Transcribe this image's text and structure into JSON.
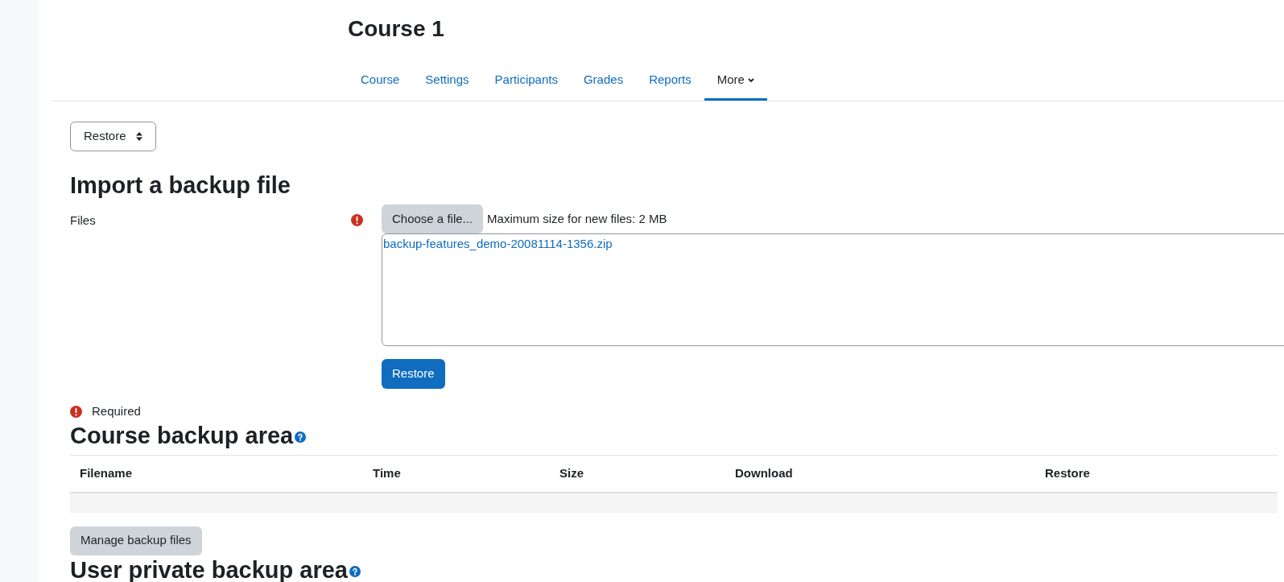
{
  "page_title": "Course 1",
  "tabs": [
    {
      "label": "Course",
      "selected": false,
      "dropdown": false
    },
    {
      "label": "Settings",
      "selected": false,
      "dropdown": false
    },
    {
      "label": "Participants",
      "selected": false,
      "dropdown": false
    },
    {
      "label": "Grades",
      "selected": false,
      "dropdown": false
    },
    {
      "label": "Reports",
      "selected": false,
      "dropdown": false
    },
    {
      "label": "More",
      "selected": true,
      "dropdown": true
    }
  ],
  "action_select": {
    "value": "Restore"
  },
  "import_section": {
    "heading": "Import a backup file",
    "field_label": "Files",
    "required": true,
    "choose_button": "Choose a file...",
    "max_size": "Maximum size for new files: 2 MB",
    "files": [
      "backup-features_demo-20081114-1356.zip"
    ],
    "submit_button": "Restore",
    "required_note": "Required"
  },
  "course_backup_area": {
    "heading": "Course backup area",
    "table": {
      "columns": [
        "Filename",
        "Time",
        "Size",
        "Download",
        "Restore"
      ]
    },
    "manage_button": "Manage backup files"
  },
  "user_private_backup_area": {
    "heading": "User private backup area"
  }
}
